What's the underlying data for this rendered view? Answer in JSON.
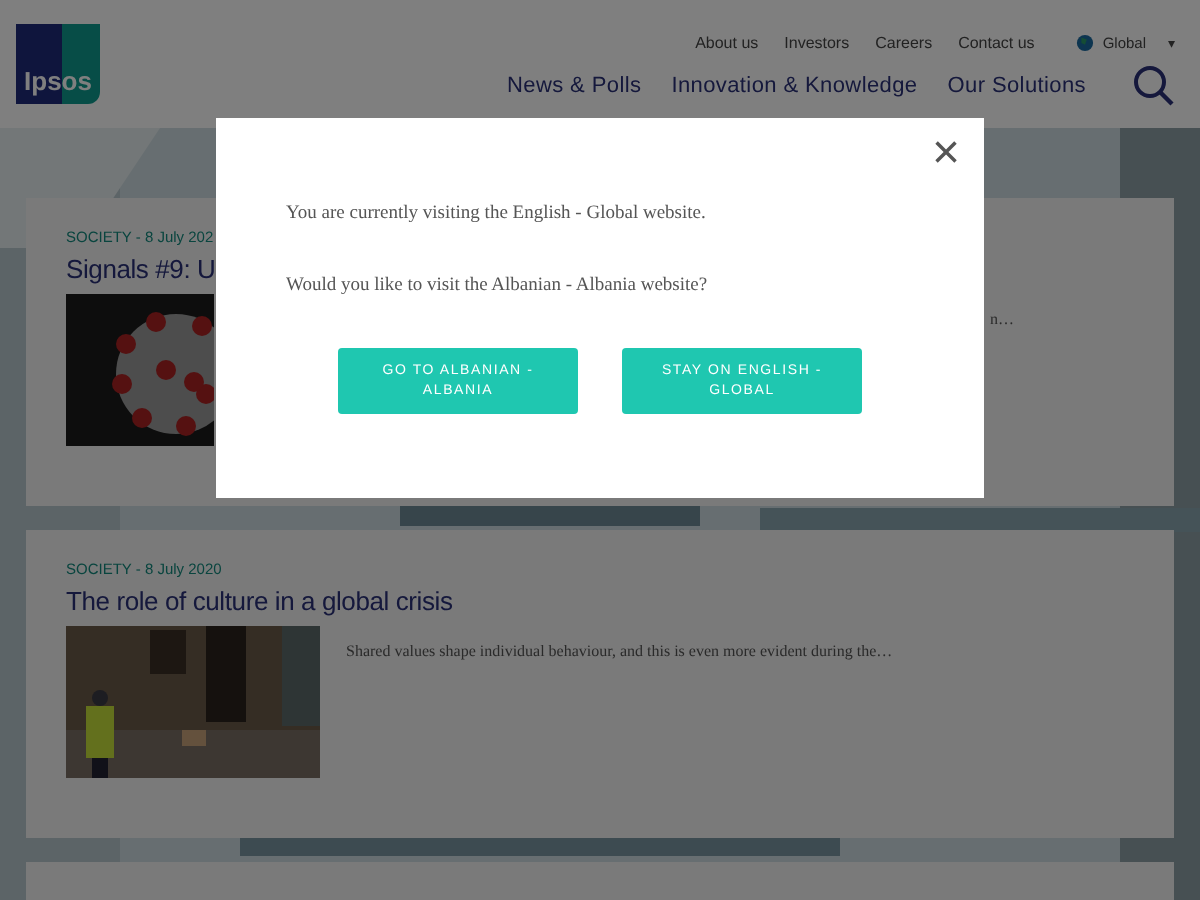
{
  "header": {
    "logo": "Ipsos",
    "top_links": [
      "About us",
      "Investors",
      "Careers",
      "Contact us"
    ],
    "region": "Global",
    "region_caret": "▾",
    "main_nav": [
      "News & Polls",
      "Innovation & Knowledge",
      "Our Solutions"
    ]
  },
  "cards": [
    {
      "meta": "SOCIETY - 8 July 202",
      "title": "Signals #9: U",
      "excerpt": "n…",
      "kind": "covered"
    },
    {
      "meta": "SOCIETY - 8 July 2020",
      "title": "The role of culture in a global crisis",
      "excerpt": "Shared values shape individual behaviour, and this is even more evident during the…",
      "kind": "open"
    }
  ],
  "modal": {
    "lines": [
      "You are currently visiting the English - Global website.",
      "Would you like to visit the Albanian - Albania website?"
    ],
    "buttons": [
      "GO TO ALBANIAN - ALBANIA",
      "STAY ON ENGLISH - GLOBAL"
    ],
    "close": "×"
  }
}
